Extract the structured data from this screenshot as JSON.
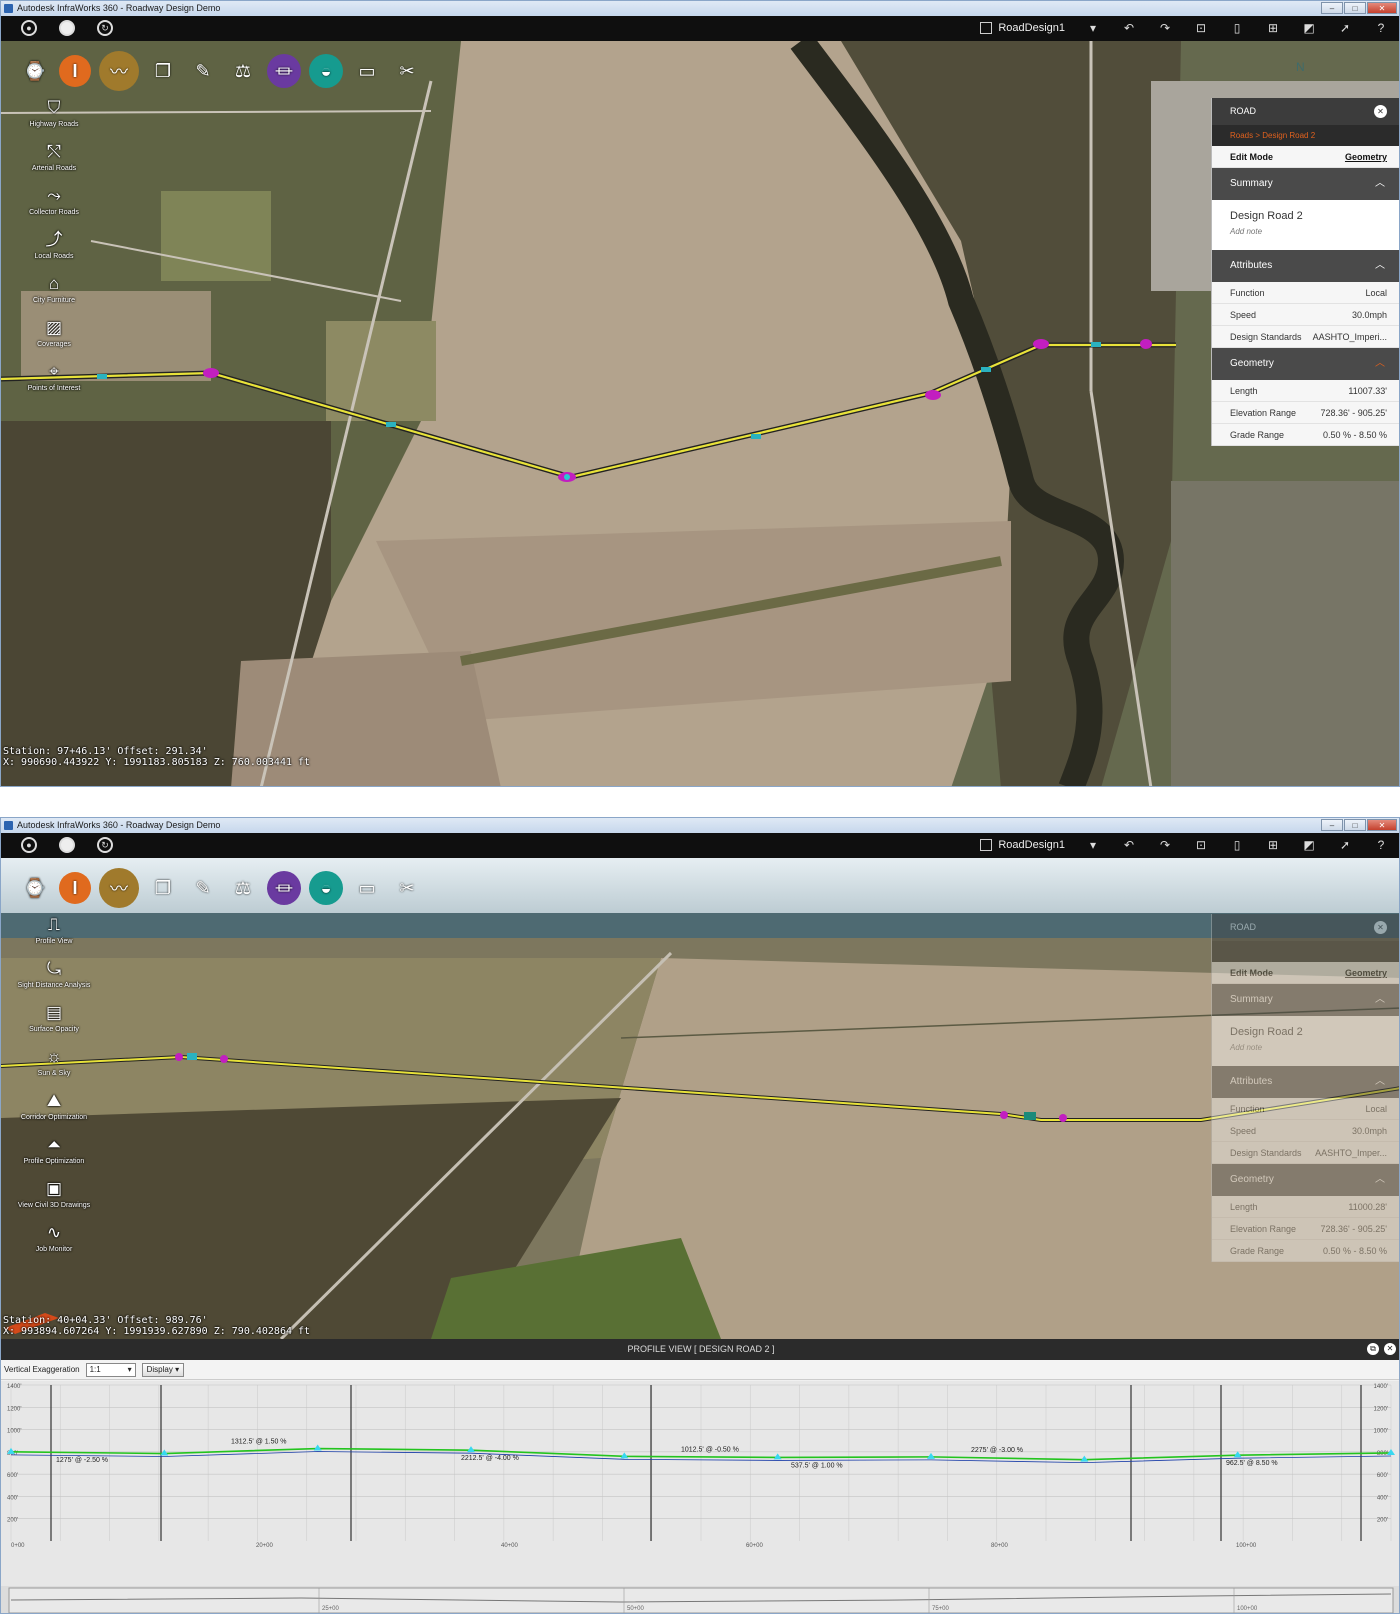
{
  "window1": {
    "title": "Autodesk InfraWorks 360 - Roadway Design Demo",
    "model_name": "RoadDesign1",
    "tool_icons": [
      "history-icon",
      "road-design-icon",
      "traffic-icon",
      "duplicate-icon",
      "sketch-icon",
      "balance-icon",
      "bridge-icon",
      "drainage-icon",
      "presentation-icon",
      "settings-icon"
    ],
    "left_menu": [
      {
        "label": "Highway Roads",
        "icon": "highway-icon"
      },
      {
        "label": "Arterial Roads",
        "icon": "arterial-icon"
      },
      {
        "label": "Collector Roads",
        "icon": "collector-icon"
      },
      {
        "label": "Local Roads",
        "icon": "local-road-icon"
      },
      {
        "label": "City Furniture",
        "icon": "city-furniture-icon"
      },
      {
        "label": "Coverages",
        "icon": "coverage-icon"
      },
      {
        "label": "Points of Interest",
        "icon": "poi-icon"
      }
    ],
    "panel": {
      "header": "ROAD",
      "breadcrumb": "Roads  >  Design Road 2",
      "edit_mode_label": "Edit Mode",
      "edit_mode_value": "Geometry",
      "summary_label": "Summary",
      "road_name": "Design Road 2",
      "add_note": "Add note",
      "attributes_label": "Attributes",
      "attributes": [
        {
          "k": "Function",
          "v": "Local"
        },
        {
          "k": "Speed",
          "v": "30.0mph"
        },
        {
          "k": "Design Standards",
          "v": "AASHTO_Imperi..."
        }
      ],
      "geometry_label": "Geometry",
      "geometry": [
        {
          "k": "Length",
          "v": "11007.33'"
        },
        {
          "k": "Elevation Range",
          "v": "728.36' - 905.25'"
        },
        {
          "k": "Grade Range",
          "v": "0.50 % - 8.50 %"
        }
      ]
    },
    "status_line1": "Station: 97+46.13'  Offset: 291.34'",
    "status_line2": "X: 990690.443922  Y: 1991183.805183  Z: 760.003441 ft"
  },
  "window2": {
    "title": "Autodesk InfraWorks 360 - Roadway Design Demo",
    "model_name": "RoadDesign1",
    "left_menu": [
      {
        "label": "Profile View",
        "icon": "profile-view-icon"
      },
      {
        "label": "Sight Distance Analysis",
        "icon": "sight-distance-icon"
      },
      {
        "label": "Surface Opacity",
        "icon": "surface-opacity-icon"
      },
      {
        "label": "Sun & Sky",
        "icon": "sun-sky-icon"
      },
      {
        "label": "Corridor Optimization",
        "icon": "corridor-optimization-icon"
      },
      {
        "label": "Profile Optimization",
        "icon": "profile-optimization-icon"
      },
      {
        "label": "View Civil 3D Drawings",
        "icon": "civil3d-drawing-icon"
      },
      {
        "label": "Job Monitor",
        "icon": "job-monitor-icon"
      }
    ],
    "panel": {
      "header": "ROAD",
      "edit_mode_label": "Edit Mode",
      "edit_mode_value": "Geometry",
      "summary_label": "Summary",
      "road_name": "Design Road 2",
      "add_note": "Add note",
      "attributes_label": "Attributes",
      "attributes": [
        {
          "k": "Function",
          "v": "Local"
        },
        {
          "k": "Speed",
          "v": "30.0mph"
        },
        {
          "k": "Design Standards",
          "v": "AASHTO_Imper..."
        }
      ],
      "geometry_label": "Geometry",
      "geometry": [
        {
          "k": "Length",
          "v": "11000.28'"
        },
        {
          "k": "Elevation Range",
          "v": "728.36' - 905.25'"
        },
        {
          "k": "Grade Range",
          "v": "0.50 % - 8.50 %"
        }
      ]
    },
    "status_line1": "Station: 40+04.33'  Offset: 989.76'",
    "status_line2": "X: 993894.607264  Y: 1991939.627890  Z: 790.402864 ft",
    "profile": {
      "title": "PROFILE VIEW [ DESIGN ROAD 2 ]",
      "vex_label": "Vertical Exaggeration",
      "vex_value": "1:1",
      "display_label": "Display",
      "y_ticks": [
        "1400'",
        "1200'",
        "1000'",
        "800'",
        "600'",
        "400'",
        "200'"
      ],
      "x_ticks": [
        "0+00",
        "20+00",
        "40+00",
        "60+00",
        "80+00",
        "100+00"
      ],
      "overview_ticks": [
        "25+00",
        "50+00",
        "75+00",
        "100+00"
      ],
      "grade_labels": [
        "1275' @ -2.50 %",
        "1312.5' @ 1.50 %",
        "2212.5' @ -4.00 %",
        "1012.5' @ -0.50 %",
        "537.5' @ 1.00 %",
        "2275' @ -3.00 %",
        "962.5' @ 8.50 %"
      ],
      "pvi_elevations_ft": [
        800,
        785,
        830,
        815,
        760,
        750,
        755,
        730,
        770,
        790
      ]
    }
  }
}
